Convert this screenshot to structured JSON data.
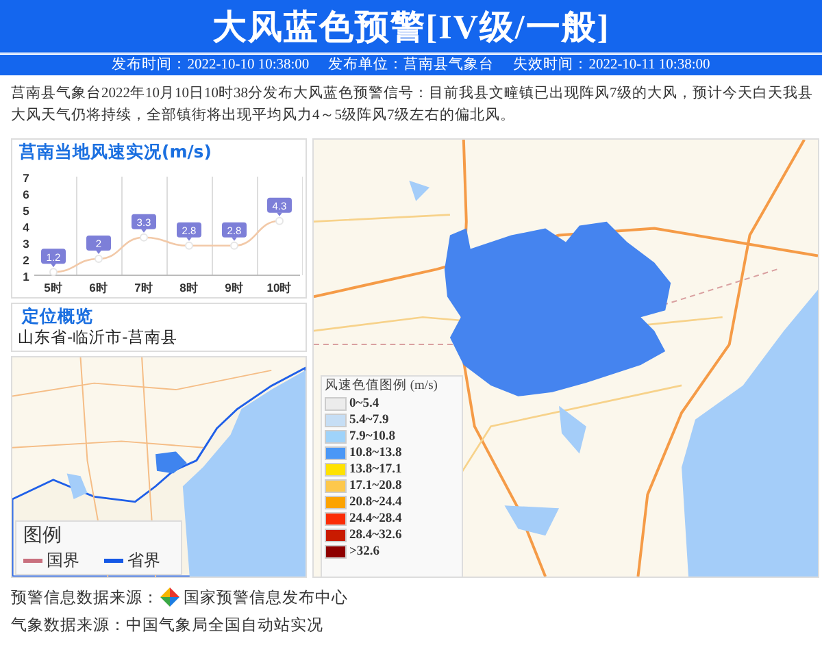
{
  "header": {
    "title": "大风蓝色预警[IV级/一般]",
    "meta": [
      "发布时间：2022-10-10 10:38:00",
      "发布单位：莒南县气象台",
      "失效时间：2022-10-11 10:38:00"
    ]
  },
  "description": "莒南县气象台2022年10月10日10时38分发布大风蓝色预警信号：目前我县文疃镇已出现阵风7级的大风，预计今天白天我县大风天气仍将持续，全部镇街将出现平均风力4～5级阵风7级左右的偏北风。",
  "wind_chart": {
    "chart_data": {
      "type": "line",
      "title": "莒南当地风速实况(m/s)",
      "categories": [
        "5时",
        "6时",
        "7时",
        "8时",
        "9时",
        "10时"
      ],
      "series": [
        {
          "color": "#f2c9a8",
          "marker": true,
          "values": [
            1.2,
            2,
            3.3,
            2.8,
            2.8,
            4.3
          ]
        }
      ],
      "ylim": [
        1,
        7
      ],
      "yticks": [
        1,
        2,
        3,
        4,
        5,
        6,
        7
      ],
      "data_labels": true
    }
  },
  "location": {
    "title": "定位概览",
    "region": "山东省-临沂市-莒南县"
  },
  "overview_map": {
    "kind": "picture",
    "legend": {
      "title": "图例",
      "items": [
        {
          "label": "国界",
          "color": "#c9707e"
        },
        {
          "label": "省界",
          "color": "#1558e6"
        }
      ]
    }
  },
  "main_map": {
    "kind": "picture",
    "legend": {
      "title": "风速色值图例 (m/s)",
      "items": [
        {
          "label": "0~5.4",
          "color": "#ececec"
        },
        {
          "label": "5.4~7.9",
          "color": "#c6def5"
        },
        {
          "label": "7.9~10.8",
          "color": "#9fd3fa"
        },
        {
          "label": "10.8~13.8",
          "color": "#4a97f6"
        },
        {
          "label": "13.8~17.1",
          "color": "#ffe200"
        },
        {
          "label": "17.1~20.8",
          "color": "#fdc84c"
        },
        {
          "label": "20.8~24.4",
          "color": "#fca300"
        },
        {
          "label": "24.4~28.4",
          "color": "#fb2c06"
        },
        {
          "label": "28.4~32.6",
          "color": "#c91b00"
        },
        {
          "label": ">32.6",
          "color": "#8e0000"
        }
      ]
    }
  },
  "sources": [
    {
      "kind": "logo",
      "label": "预警信息数据来源：",
      "value": "国家预警信息发布中心"
    },
    {
      "kind": "plain",
      "label": "气象数据来源：",
      "value": "中国气象局全国自动站实况"
    }
  ]
}
